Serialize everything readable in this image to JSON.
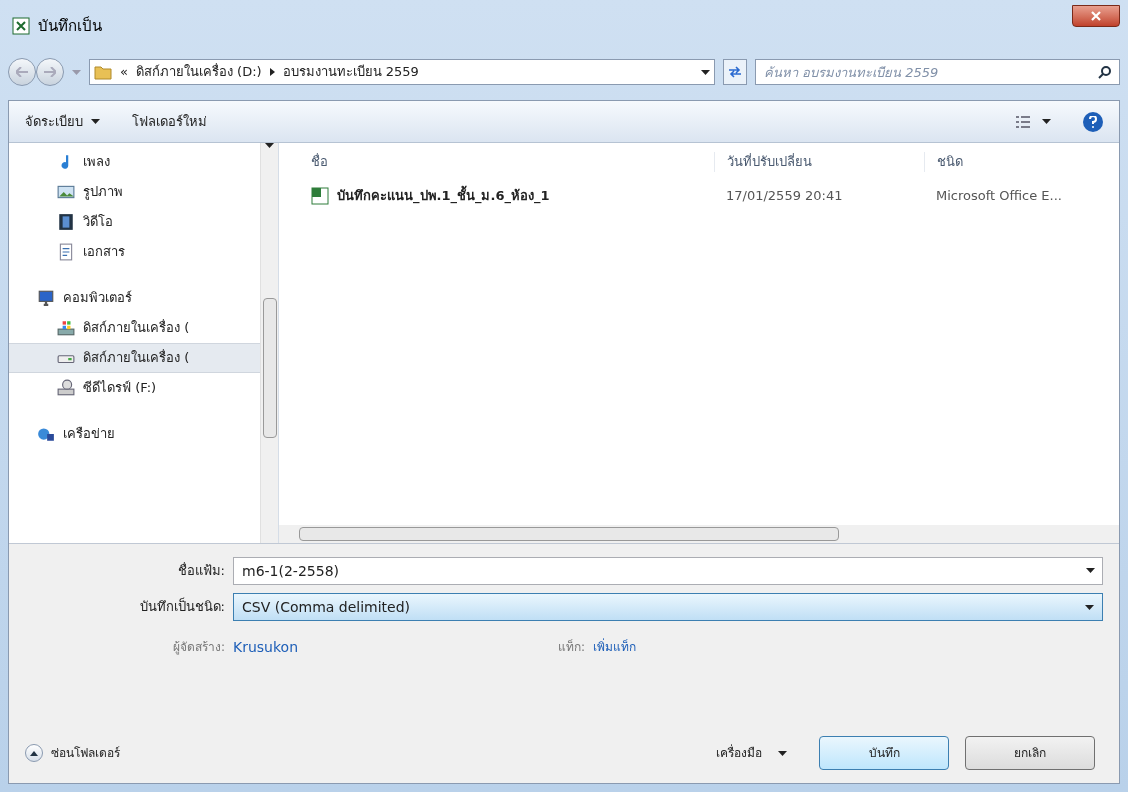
{
  "window": {
    "title": "บันทึกเป็น"
  },
  "address": {
    "overflow": "«",
    "crumbs": [
      "ดิสก์ภายในเครื่อง (D:)",
      "อบรมงานทะเบียน 2559"
    ]
  },
  "search": {
    "placeholder": "ค้นหา อบรมงานทะเบียน 2559"
  },
  "toolbar": {
    "organize": "จัดระเบียบ",
    "new_folder": "โฟลเดอร์ใหม่"
  },
  "sidebar": {
    "items": [
      {
        "label": "เพลง",
        "kind": "music",
        "group": false,
        "selected": false
      },
      {
        "label": "รูปภาพ",
        "kind": "pictures",
        "group": false,
        "selected": false
      },
      {
        "label": "วิดีโอ",
        "kind": "video",
        "group": false,
        "selected": false
      },
      {
        "label": "เอกสาร",
        "kind": "document",
        "group": false,
        "selected": false
      },
      {
        "label": "คอมพิวเตอร์",
        "kind": "computer",
        "group": true,
        "selected": false
      },
      {
        "label": "ดิสก์ภายในเครื่อง (",
        "kind": "system-drive",
        "group": false,
        "selected": false
      },
      {
        "label": "ดิสก์ภายในเครื่อง (",
        "kind": "drive",
        "group": false,
        "selected": true
      },
      {
        "label": "ซีดีไดรฟ์ (F:)",
        "kind": "cd",
        "group": false,
        "selected": false
      },
      {
        "label": "เครือข่าย",
        "kind": "network",
        "group": true,
        "selected": false
      }
    ]
  },
  "table": {
    "columns": [
      "ชื่อ",
      "วันที่ปรับเปลี่ยน",
      "ชนิด"
    ],
    "rows": [
      {
        "name": "บันทึกคะแนน_ปพ.1_ชั้น_ม.6_ห้อง_1",
        "modified": "17/01/2559 20:41",
        "type": "Microsoft Office E..."
      }
    ]
  },
  "form": {
    "filename_label": "ชื่อแฟ้ม:",
    "filename": "m6-1(2-2558)",
    "type_label": "บันทึกเป็นชนิด:",
    "type": "CSV (Comma delimited)",
    "author_label": "ผู้จัดสร้าง:",
    "author": "Krusukon",
    "tags_label": "แท็ก:",
    "tags": "เพิ่มแท็ก"
  },
  "footer": {
    "hide_folders": "ซ่อนโฟลเดอร์",
    "tools": "เครื่องมือ",
    "save": "บันทึก",
    "cancel": "ยกเลิก"
  }
}
